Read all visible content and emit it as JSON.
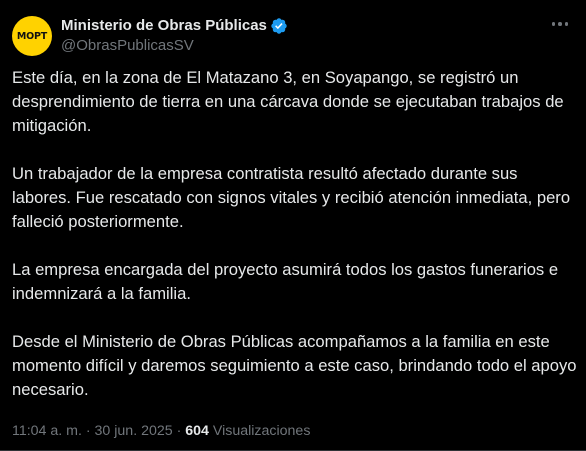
{
  "author": {
    "avatar_text": "MOPT",
    "avatar_color": "#ffd200",
    "display_name": "Ministerio de Obras Públicas",
    "verified_icon": "verified-badge-icon",
    "verified_color": "#1d9bf0",
    "handle": "@ObrasPublicasSV"
  },
  "more_icon": "more-options-icon",
  "tweet": {
    "paragraphs": [
      "Este día, en la zona de El Matazano 3, en Soyapango, se registró un desprendimiento de tierra en una cárcava donde se ejecutaban trabajos de mitigación.",
      "Un trabajador de la empresa contratista resultó afectado durante sus labores. Fue rescatado con signos vitales y recibió atención inmediata, pero falleció posteriormente.",
      "La empresa encargada del proyecto asumirá todos los gastos funerarios e indemnizará a la familia.",
      "Desde el Ministerio de Obras Públicas acompañamos a la familia en este momento difícil y daremos seguimiento a este caso, brindando todo el apoyo necesario."
    ]
  },
  "meta": {
    "time": "11:04 a. m.",
    "separator1": " · ",
    "date": "30 jun. 2025",
    "separator2": " · ",
    "views_count": "604",
    "views_label": " Visualizaciones"
  },
  "colors": {
    "background": "#000000",
    "text": "#e7e9ea",
    "secondary": "#71767b"
  }
}
